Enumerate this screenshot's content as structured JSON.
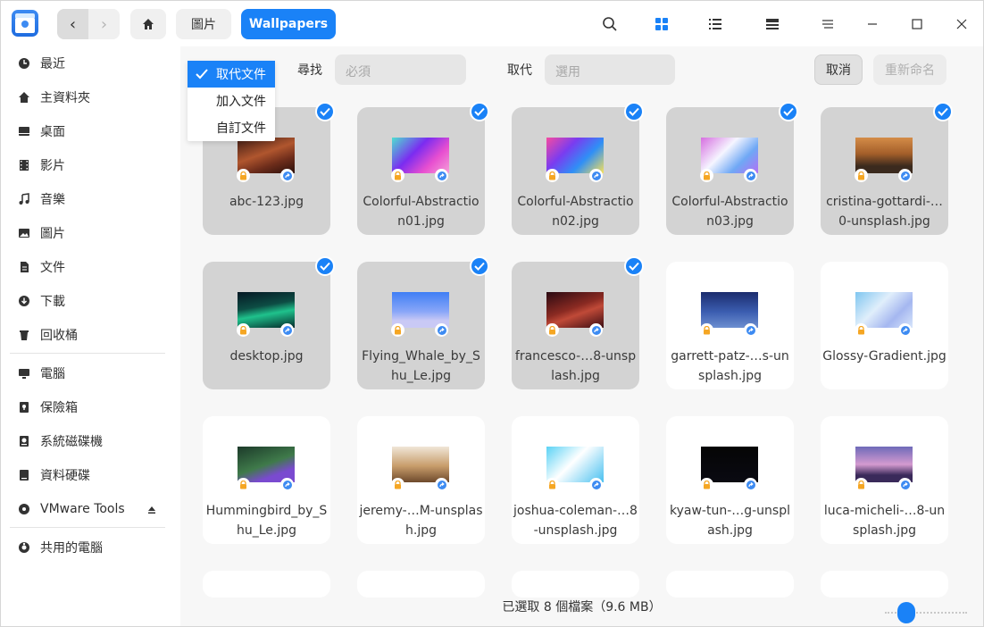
{
  "window": {
    "title": "Wallpapers"
  },
  "toolbar": {
    "back_icon": "chevron-left-icon",
    "forward_icon": "chevron-right-icon",
    "home_icon": "home-icon",
    "breadcrumbs": [
      "圖片",
      "Wallpapers"
    ],
    "view_icons": [
      "search-icon",
      "icon-view-icon",
      "list-view-icon",
      "tree-view-icon",
      "menu-icon"
    ],
    "window_controls": [
      "minimize-icon",
      "maximize-icon",
      "close-icon"
    ]
  },
  "sidebar": {
    "items": [
      {
        "label": "最近",
        "icon": "clock-icon"
      },
      {
        "label": "主資料夾",
        "icon": "home-icon"
      },
      {
        "label": "桌面",
        "icon": "desktop-icon"
      },
      {
        "label": "影片",
        "icon": "video-icon"
      },
      {
        "label": "音樂",
        "icon": "music-icon"
      },
      {
        "label": "圖片",
        "icon": "picture-icon"
      },
      {
        "label": "文件",
        "icon": "document-icon"
      },
      {
        "label": "下載",
        "icon": "download-icon"
      },
      {
        "label": "回收桶",
        "icon": "trash-icon"
      }
    ],
    "devices": [
      {
        "label": "電腦",
        "icon": "computer-icon"
      },
      {
        "label": "保險箱",
        "icon": "vault-icon"
      },
      {
        "label": "系統磁碟機",
        "icon": "system-disk-icon"
      },
      {
        "label": "資料硬碟",
        "icon": "data-disk-icon"
      },
      {
        "label": "VMware Tools",
        "icon": "disc-icon"
      }
    ],
    "network": [
      {
        "label": "共用的電腦",
        "icon": "network-icon"
      }
    ]
  },
  "rename_bar": {
    "mode_options": [
      "取代文件",
      "加入文件",
      "自訂文件"
    ],
    "selected_mode": "取代文件",
    "find_label": "尋找",
    "find_placeholder": "必須",
    "replace_label": "取代",
    "replace_placeholder": "選用",
    "cancel_label": "取消",
    "rename_label": "重新命名"
  },
  "files": [
    {
      "name": "abc-123.jpg",
      "selected": true
    },
    {
      "name": "Colorful-Abstraction01.jpg",
      "selected": true
    },
    {
      "name": "Colorful-Abstraction02.jpg",
      "selected": true
    },
    {
      "name": "Colorful-Abstraction03.jpg",
      "selected": true
    },
    {
      "name": "cristina-gottardi-…0-unsplash.jpg",
      "selected": true
    },
    {
      "name": "desktop.jpg",
      "selected": true
    },
    {
      "name": "Flying_Whale_by_Shu_Le.jpg",
      "selected": true
    },
    {
      "name": "francesco-…8-unsplash.jpg",
      "selected": true
    },
    {
      "name": "garrett-patz-…s-unsplash.jpg",
      "selected": false
    },
    {
      "name": "Glossy-Gradient.jpg",
      "selected": false
    },
    {
      "name": "Hummingbird_by_Shu_Le.jpg",
      "selected": false
    },
    {
      "name": "jeremy-…M-unsplash.jpg",
      "selected": false
    },
    {
      "name": "joshua-coleman-…8-unsplash.jpg",
      "selected": false
    },
    {
      "name": "kyaw-tun-…g-unsplash.jpg",
      "selected": false
    },
    {
      "name": "luca-micheli-…8-unsplash.jpg",
      "selected": false
    }
  ],
  "status": {
    "text": "已選取 8 個檔案（9.6 MB）"
  },
  "colors": {
    "accent": "#1a82f7",
    "selected_tile": "#d3d3d3",
    "lock_badge": "#f5a623"
  }
}
